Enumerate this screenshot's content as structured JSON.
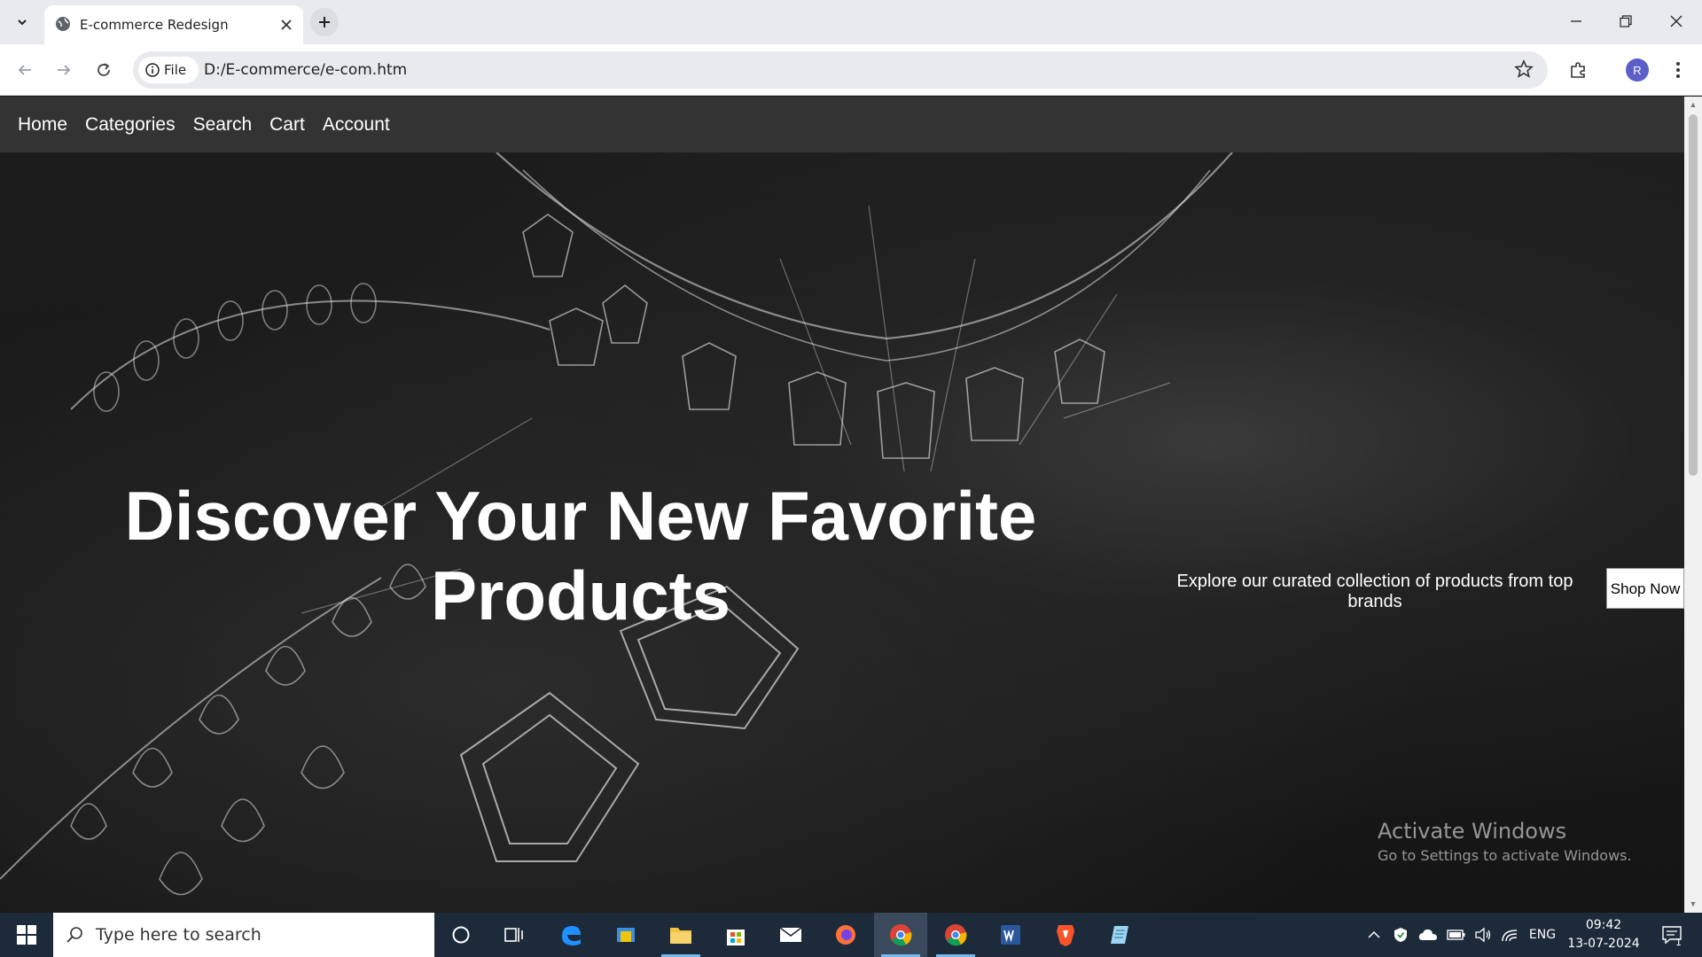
{
  "browser": {
    "tab_title": "E-commerce Redesign",
    "site_chip_label": "File",
    "url": "D:/E-commerce/e-com.htm",
    "profile_initial": "R"
  },
  "site": {
    "nav": [
      "Home",
      "Categories",
      "Search",
      "Cart",
      "Account"
    ],
    "hero": {
      "title": "Discover Your New Favorite Products",
      "subtitle": "Explore our curated collection of products from top brands",
      "cta": "Shop Now"
    }
  },
  "watermark": {
    "title": "Activate Windows",
    "subtitle": "Go to Settings to activate Windows."
  },
  "taskbar": {
    "search_placeholder": "Type here to search",
    "language": "ENG",
    "time": "09:42",
    "date": "13-07-2024",
    "notification_count": "1",
    "apps": [
      "cortana-icon",
      "task-view-icon",
      "edge-icon",
      "outlook-icon",
      "file-explorer-icon",
      "store-icon",
      "mail-icon",
      "firefox-icon",
      "chrome-icon",
      "chrome-icon",
      "word-icon",
      "brave-icon",
      "notepad-icon"
    ]
  }
}
